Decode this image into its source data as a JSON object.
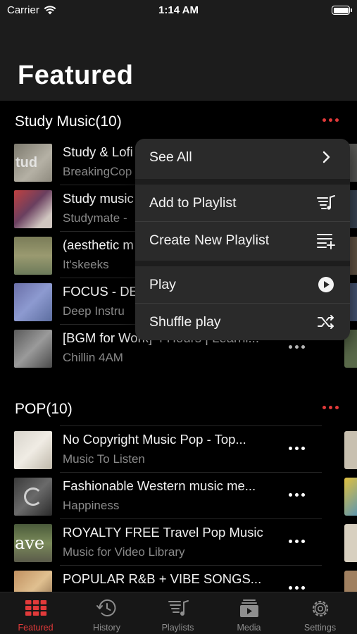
{
  "status_bar": {
    "carrier": "Carrier",
    "time": "1:14 AM"
  },
  "page": {
    "title": "Featured"
  },
  "sections": [
    {
      "title": "Study Music(10)",
      "tracks": [
        {
          "title": "Study & Lofi",
          "subtitle": "BreakingCop"
        },
        {
          "title": "Study music",
          "subtitle": "Studymate -"
        },
        {
          "title": "(aesthetic m",
          "subtitle": "It'skeeks"
        },
        {
          "title": "FOCUS - DE",
          "subtitle": "Deep Instru"
        },
        {
          "title": "[BGM for Work] 4 Hours | Learni...",
          "subtitle": "Chillin 4AM"
        }
      ]
    },
    {
      "title": "POP(10)",
      "tracks": [
        {
          "title": "No Copyright Music Pop - Top...",
          "subtitle": "Music To Listen"
        },
        {
          "title": "Fashionable Western music me...",
          "subtitle": "Happiness"
        },
        {
          "title": "ROYALTY FREE Travel Pop Music",
          "subtitle": "Music for Video Library"
        },
        {
          "title": "POPULAR R&B + VIBE SONGS...",
          "subtitle": ""
        }
      ]
    }
  ],
  "context_menu": {
    "items": [
      {
        "label": "See All",
        "icon": "chevron-right-icon"
      },
      {
        "label": "Add to Playlist",
        "icon": "add-to-playlist-icon"
      },
      {
        "label": "Create New Playlist",
        "icon": "new-playlist-icon"
      },
      {
        "label": "Play",
        "icon": "play-circle-icon"
      },
      {
        "label": "Shuffle play",
        "icon": "shuffle-icon"
      }
    ]
  },
  "tab_bar": {
    "tabs": [
      {
        "label": "Featured",
        "icon": "grid-icon",
        "active": true
      },
      {
        "label": "History",
        "icon": "history-icon",
        "active": false
      },
      {
        "label": "Playlists",
        "icon": "playlists-icon",
        "active": false
      },
      {
        "label": "Media",
        "icon": "media-icon",
        "active": false
      },
      {
        "label": "Settings",
        "icon": "gear-icon",
        "active": false
      }
    ]
  },
  "colors": {
    "accent": "#e23a3a",
    "background": "#000000",
    "menu": "#2a2a2a"
  }
}
